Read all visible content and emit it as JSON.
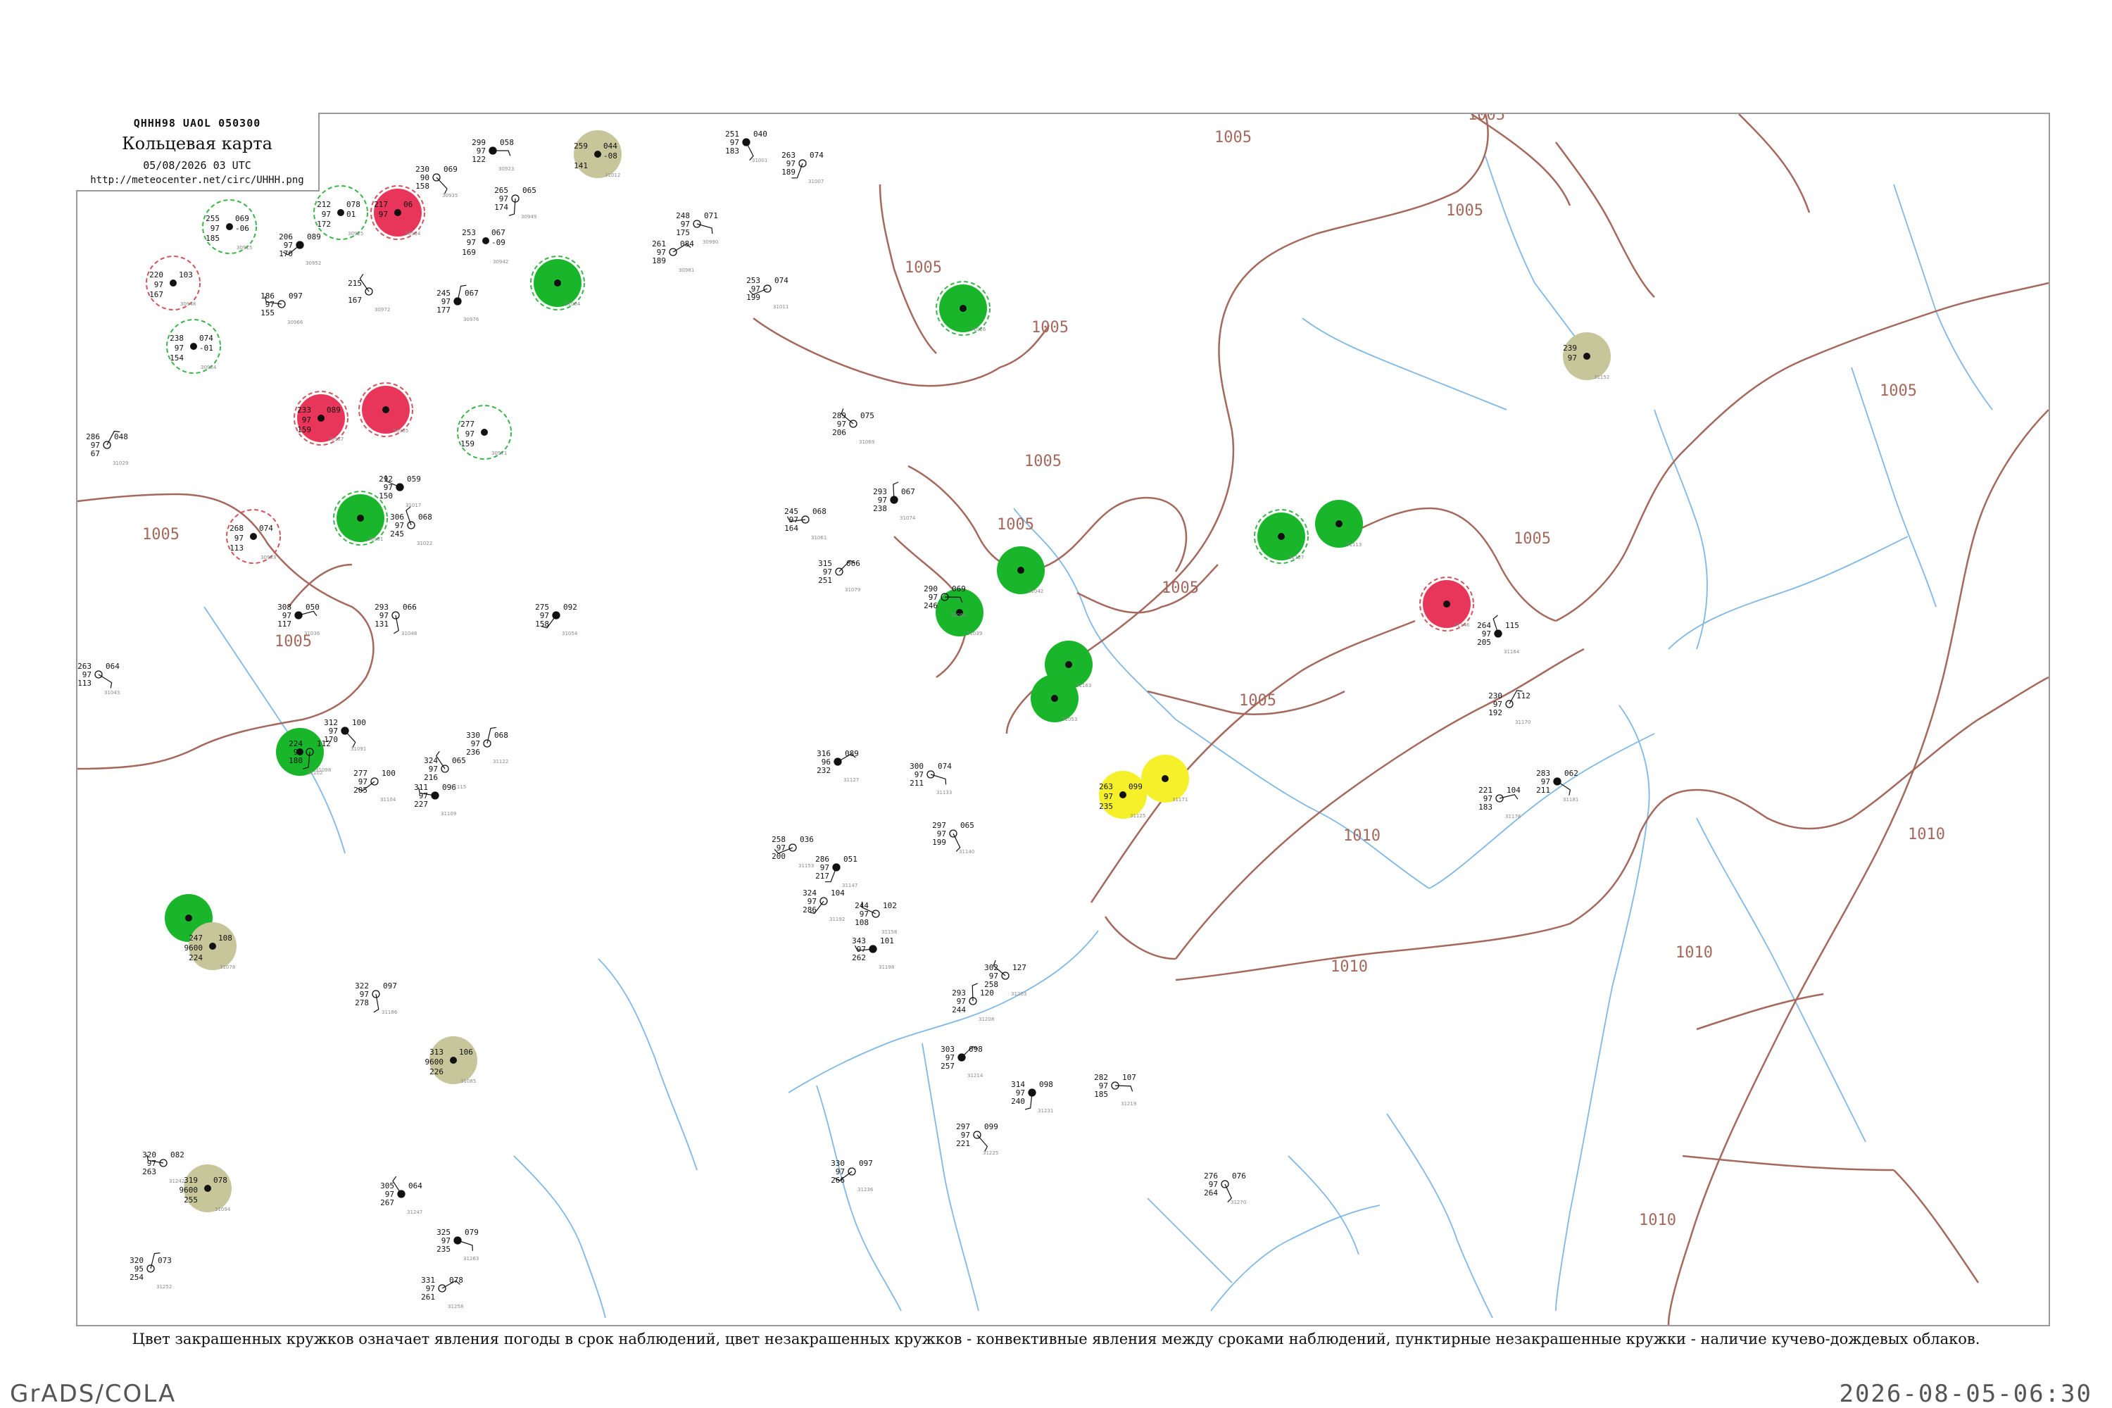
{
  "header": {
    "product_code": "QHHH98  UAOL  050300",
    "title": "Кольцевая карта",
    "date": "05/08/2026 03 UTC",
    "url": "http://meteocenter.net/circ/UHHH.png"
  },
  "legend_note": "Цвет закрашенных кружков означает явления погоды в срок наблюдений, цвет незакрашенных кружков - конвективные явления между сроками наблюдений, пунктирные незакрашенные кружки - наличие кучево-дождевых облаков.",
  "footer": {
    "software": "GrADS/COLA",
    "timestamp": "2026-08-05-06:30"
  },
  "colors": {
    "isobar": "#a5685c",
    "river": "#7fb8e6",
    "rain_fill": "#19b52a",
    "thunder_fill": "#e8365a",
    "haze_fill": "#c7c59a",
    "snow_fill": "#f5f02a",
    "cb_ring": "#3ab54a",
    "thunder_ring": "#d2545a"
  },
  "isobar_labels": [
    {
      "id": "iso-1005-nw",
      "text": "1005"
    },
    {
      "id": "iso-1005-w",
      "text": "1005"
    },
    {
      "id": "iso-1005-c1",
      "text": "1005"
    },
    {
      "id": "iso-1005-c2",
      "text": "1005"
    },
    {
      "id": "iso-1005-c3",
      "text": "1005"
    },
    {
      "id": "iso-1005-c4",
      "text": "1005"
    },
    {
      "id": "iso-1005-c5",
      "text": "1005"
    },
    {
      "id": "iso-1005-c6",
      "text": "1005"
    },
    {
      "id": "iso-1005-n",
      "text": "1005"
    },
    {
      "id": "iso-1005-ne",
      "text": "1005"
    },
    {
      "id": "iso-1005-e",
      "text": "1005"
    },
    {
      "id": "iso-1005-e2",
      "text": "1005"
    },
    {
      "id": "iso-1005-sw",
      "text": "1005"
    },
    {
      "id": "iso-1010-c",
      "text": "1010"
    },
    {
      "id": "iso-1010-s",
      "text": "1010"
    },
    {
      "id": "iso-1010-e",
      "text": "1010"
    },
    {
      "id": "iso-1010-se",
      "text": "1010"
    },
    {
      "id": "iso-1010-e2",
      "text": "1010"
    }
  ],
  "stations": [
    {
      "name": "station-01",
      "temp": "255",
      "pres": "97",
      "dew": "069",
      "td": "-06",
      "vis": "185",
      "id": "30915",
      "fill": "none",
      "ring": "cb"
    },
    {
      "name": "station-02",
      "temp": "212",
      "pres": "97",
      "dew": "078",
      "td": "01",
      "vis": "172",
      "id": "30925",
      "fill": "none",
      "ring": "cb"
    },
    {
      "name": "station-03",
      "temp": "217",
      "pres": "97",
      "dew": "06",
      "td": "",
      "vis": "",
      "id": "30934",
      "fill": "thunder",
      "ring": "thunder"
    },
    {
      "name": "station-04",
      "temp": "253",
      "pres": "97",
      "dew": "067",
      "td": "-09",
      "vis": "169",
      "id": "30942",
      "fill": "none",
      "ring": "none"
    },
    {
      "name": "station-05",
      "temp": "220",
      "pres": "97",
      "dew": "103",
      "td": "",
      "vis": "167",
      "id": "30948",
      "fill": "none",
      "ring": "thunder"
    },
    {
      "name": "station-06",
      "temp": "238",
      "pres": "97",
      "dew": "074",
      "td": "-01",
      "vis": "154",
      "id": "30954",
      "fill": "none",
      "ring": "cb"
    },
    {
      "name": "station-07",
      "temp": "233",
      "pres": "97",
      "dew": "089",
      "td": "",
      "vis": "159",
      "id": "30957",
      "fill": "thunder",
      "ring": "thunder"
    },
    {
      "name": "station-08",
      "temp": "",
      "pres": "",
      "dew": "",
      "td": "",
      "vis": "",
      "id": "30965",
      "fill": "thunder",
      "ring": "thunder"
    },
    {
      "name": "station-09",
      "temp": "277",
      "pres": "97",
      "dew": "",
      "td": "",
      "vis": "159",
      "id": "30971",
      "fill": "none",
      "ring": "cb"
    },
    {
      "name": "station-10",
      "temp": "268",
      "pres": "97",
      "dew": "074",
      "td": "",
      "vis": "113",
      "id": "30983",
      "fill": "none",
      "ring": "thunder"
    },
    {
      "name": "station-11",
      "temp": "",
      "pres": "",
      "dew": "",
      "td": "",
      "vis": "",
      "id": "30991",
      "fill": "rain",
      "ring": "cb"
    },
    {
      "name": "station-12",
      "temp": "",
      "pres": "",
      "dew": "",
      "td": "",
      "vis": "",
      "id": "31004",
      "fill": "rain",
      "ring": "cb"
    },
    {
      "name": "station-13",
      "temp": "259",
      "pres": "",
      "dew": "044",
      "td": "-08",
      "vis": "141",
      "id": "31012",
      "fill": "haze",
      "ring": "none"
    },
    {
      "name": "station-14",
      "temp": "",
      "pres": "",
      "dew": "",
      "td": "",
      "vis": "",
      "id": "31026",
      "fill": "rain",
      "ring": "cb"
    },
    {
      "name": "station-15",
      "temp": "",
      "pres": "",
      "dew": "",
      "td": "",
      "vis": "",
      "id": "31039",
      "fill": "rain",
      "ring": "none"
    },
    {
      "name": "station-16",
      "temp": "",
      "pres": "",
      "dew": "",
      "td": "",
      "vis": "",
      "id": "31042",
      "fill": "rain",
      "ring": "none"
    },
    {
      "name": "station-17",
      "temp": "",
      "pres": "",
      "dew": "",
      "td": "",
      "vis": "",
      "id": "31053",
      "fill": "rain",
      "ring": "none"
    },
    {
      "name": "station-18",
      "temp": "",
      "pres": "",
      "dew": "",
      "td": "",
      "vis": "",
      "id": "31067",
      "fill": "rain",
      "ring": "none"
    },
    {
      "name": "station-19",
      "temp": "247",
      "pres": "9600",
      "dew": "108",
      "td": "",
      "vis": "224",
      "id": "31078",
      "fill": "haze",
      "ring": "none"
    },
    {
      "name": "station-20",
      "temp": "313",
      "pres": "9600",
      "dew": "106",
      "td": "",
      "vis": "226",
      "id": "31085",
      "fill": "haze",
      "ring": "none"
    },
    {
      "name": "station-21",
      "temp": "319",
      "pres": "9600",
      "dew": "078",
      "td": "",
      "vis": "255",
      "id": "31094",
      "fill": "haze",
      "ring": "none"
    },
    {
      "name": "station-22",
      "temp": "",
      "pres": "",
      "dew": "",
      "td": "",
      "vis": "",
      "id": "31102",
      "fill": "rain",
      "ring": "none"
    },
    {
      "name": "station-23",
      "temp": "",
      "pres": "",
      "dew": "",
      "td": "",
      "vis": "",
      "id": "31113",
      "fill": "rain",
      "ring": "none"
    },
    {
      "name": "station-24",
      "temp": "263",
      "pres": "97",
      "dew": "099",
      "td": "",
      "vis": "235",
      "id": "31125",
      "fill": "snow",
      "ring": "none"
    },
    {
      "name": "station-25",
      "temp": "",
      "pres": "",
      "dew": "",
      "td": "",
      "vis": "",
      "id": "31137",
      "fill": "rain",
      "ring": "cb"
    },
    {
      "name": "station-26",
      "temp": "",
      "pres": "",
      "dew": "",
      "td": "",
      "vis": "",
      "id": "31146",
      "fill": "thunder",
      "ring": "thunder"
    },
    {
      "name": "station-27",
      "temp": "239",
      "pres": "97",
      "dew": "",
      "td": "",
      "vis": "",
      "id": "31152",
      "fill": "haze",
      "ring": "none"
    },
    {
      "name": "station-28",
      "temp": "",
      "pres": "",
      "dew": "",
      "td": "",
      "vis": "",
      "id": "31163",
      "fill": "rain",
      "ring": "none"
    },
    {
      "name": "station-29",
      "temp": "",
      "pres": "",
      "dew": "",
      "td": "",
      "vis": "",
      "id": "31171",
      "fill": "snow",
      "ring": "none"
    }
  ],
  "plain_stations": [
    {
      "t": "299",
      "p": "97",
      "d": "058",
      "v": "122",
      "id": "30923"
    },
    {
      "t": "230",
      "p": "90",
      "d": "069",
      "v": "158",
      "id": "30935"
    },
    {
      "t": "265",
      "p": "97",
      "d": "065",
      "v": "174",
      "id": "30949"
    },
    {
      "t": "206",
      "p": "97",
      "d": "089",
      "v": "170",
      "id": "30952"
    },
    {
      "t": "186",
      "p": "97",
      "d": "097",
      "v": "155",
      "id": "30966"
    },
    {
      "t": "215",
      "p": "",
      "d": "",
      "v": "167",
      "id": "30972"
    },
    {
      "t": "245",
      "p": "97",
      "d": "067",
      "v": "177",
      "id": "30976"
    },
    {
      "t": "261",
      "p": "97",
      "d": "084",
      "v": "189",
      "id": "30981"
    },
    {
      "t": "248",
      "p": "97",
      "d": "071",
      "v": "175",
      "id": "30990"
    },
    {
      "t": "251",
      "p": "97",
      "d": "040",
      "v": "183",
      "id": "31001"
    },
    {
      "t": "263",
      "p": "97",
      "d": "074",
      "v": "189",
      "id": "31007"
    },
    {
      "t": "253",
      "p": "97",
      "d": "074",
      "v": "199",
      "id": "31011"
    },
    {
      "t": "292",
      "p": "97",
      "d": "059",
      "v": "150",
      "id": "31017"
    },
    {
      "t": "306",
      "p": "97",
      "d": "068",
      "v": "245",
      "id": "31022"
    },
    {
      "t": "286",
      "p": "97",
      "d": "048",
      "v": "67",
      "id": "31029"
    },
    {
      "t": "308",
      "p": "97",
      "d": "050",
      "v": "117",
      "id": "31036"
    },
    {
      "t": "263",
      "p": "97",
      "d": "064",
      "v": "113",
      "id": "31043"
    },
    {
      "t": "293",
      "p": "97",
      "d": "066",
      "v": "131",
      "id": "31048"
    },
    {
      "t": "275",
      "p": "97",
      "d": "092",
      "v": "158",
      "id": "31054"
    },
    {
      "t": "245",
      "p": "97",
      "d": "068",
      "v": "164",
      "id": "31061"
    },
    {
      "t": "289",
      "p": "97",
      "d": "075",
      "v": "206",
      "id": "31069"
    },
    {
      "t": "293",
      "p": "97",
      "d": "067",
      "v": "238",
      "id": "31074"
    },
    {
      "t": "315",
      "p": "97",
      "d": "066",
      "v": "251",
      "id": "31079"
    },
    {
      "t": "290",
      "p": "97",
      "d": "069",
      "v": "246",
      "id": "31086"
    },
    {
      "t": "312",
      "p": "97",
      "d": "100",
      "v": "170",
      "id": "31091"
    },
    {
      "t": "224",
      "p": "97",
      "d": "112",
      "v": "180",
      "id": "31098"
    },
    {
      "t": "277",
      "p": "97",
      "d": "100",
      "v": "205",
      "id": "31104"
    },
    {
      "t": "311",
      "p": "97",
      "d": "096",
      "v": "227",
      "id": "31109"
    },
    {
      "t": "324",
      "p": "97",
      "d": "065",
      "v": "216",
      "id": "31115"
    },
    {
      "t": "330",
      "p": "97",
      "d": "068",
      "v": "236",
      "id": "31122"
    },
    {
      "t": "316",
      "p": "96",
      "d": "089",
      "v": "232",
      "id": "31127"
    },
    {
      "t": "300",
      "p": "97",
      "d": "074",
      "v": "211",
      "id": "31133"
    },
    {
      "t": "297",
      "p": "97",
      "d": "065",
      "v": "199",
      "id": "31140"
    },
    {
      "t": "286",
      "p": "97",
      "d": "051",
      "v": "217",
      "id": "31147"
    },
    {
      "t": "258",
      "p": "97",
      "d": "036",
      "v": "200",
      "id": "31153"
    },
    {
      "t": "244",
      "p": "97",
      "d": "102",
      "v": "108",
      "id": "31158"
    },
    {
      "t": "264",
      "p": "97",
      "d": "115",
      "v": "205",
      "id": "31164"
    },
    {
      "t": "230",
      "p": "97",
      "d": "112",
      "v": "192",
      "id": "31170"
    },
    {
      "t": "221",
      "p": "97",
      "d": "104",
      "v": "183",
      "id": "31176"
    },
    {
      "t": "283",
      "p": "97",
      "d": "062",
      "v": "211",
      "id": "31181"
    },
    {
      "t": "322",
      "p": "97",
      "d": "097",
      "v": "278",
      "id": "31186"
    },
    {
      "t": "324",
      "p": "97",
      "d": "104",
      "v": "286",
      "id": "31192"
    },
    {
      "t": "343",
      "p": "97",
      "d": "101",
      "v": "262",
      "id": "31198"
    },
    {
      "t": "302",
      "p": "97",
      "d": "127",
      "v": "258",
      "id": "31203"
    },
    {
      "t": "293",
      "p": "97",
      "d": "120",
      "v": "244",
      "id": "31208"
    },
    {
      "t": "303",
      "p": "97",
      "d": "098",
      "v": "257",
      "id": "31214"
    },
    {
      "t": "282",
      "p": "97",
      "d": "107",
      "v": "185",
      "id": "31219"
    },
    {
      "t": "297",
      "p": "97",
      "d": "099",
      "v": "221",
      "id": "31225"
    },
    {
      "t": "314",
      "p": "97",
      "d": "098",
      "v": "240",
      "id": "31231"
    },
    {
      "t": "330",
      "p": "97",
      "d": "097",
      "v": "266",
      "id": "31236"
    },
    {
      "t": "320",
      "p": "97",
      "d": "082",
      "v": "263",
      "id": "31242"
    },
    {
      "t": "305",
      "p": "97",
      "d": "064",
      "v": "267",
      "id": "31247"
    },
    {
      "t": "320",
      "p": "95",
      "d": "073",
      "v": "254",
      "id": "31252"
    },
    {
      "t": "331",
      "p": "97",
      "d": "078",
      "v": "261",
      "id": "31258"
    },
    {
      "t": "325",
      "p": "97",
      "d": "079",
      "v": "235",
      "id": "31263"
    },
    {
      "t": "276",
      "p": "97",
      "d": "076",
      "v": "264",
      "id": "31270"
    }
  ]
}
